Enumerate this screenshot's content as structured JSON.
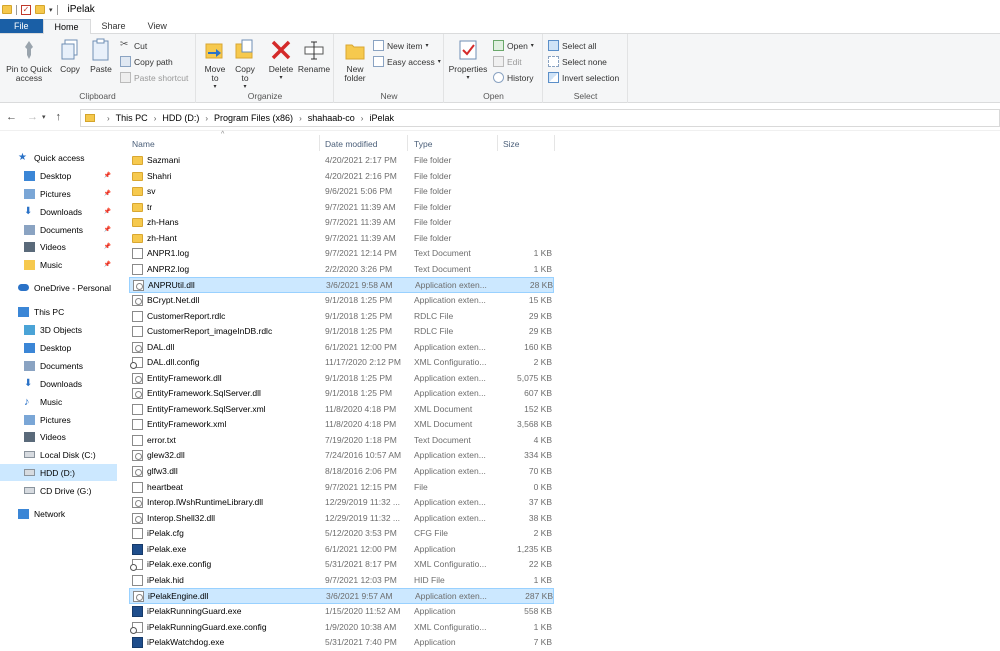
{
  "window": {
    "title": "iPelak"
  },
  "tabs": [
    "File",
    "Home",
    "Share",
    "View"
  ],
  "ribbon": {
    "clipboard": {
      "label": "Clipboard",
      "pin": "Pin to Quick access",
      "copy": "Copy",
      "paste": "Paste",
      "cut": "Cut",
      "copy_path": "Copy path",
      "paste_shortcut": "Paste shortcut"
    },
    "organize": {
      "label": "Organize",
      "move_to": "Move to",
      "copy_to": "Copy to",
      "delete": "Delete",
      "rename": "Rename"
    },
    "new": {
      "label": "New",
      "new_folder": "New folder",
      "new_item": "New item",
      "easy_access": "Easy access"
    },
    "open": {
      "label": "Open",
      "properties": "Properties",
      "open": "Open",
      "edit": "Edit",
      "history": "History"
    },
    "select": {
      "label": "Select",
      "select_all": "Select all",
      "select_none": "Select none",
      "invert": "Invert selection"
    }
  },
  "breadcrumb": [
    "This PC",
    "HDD (D:)",
    "Program Files (x86)",
    "shahaab-co",
    "iPelak"
  ],
  "nav": [
    {
      "label": "Quick access",
      "icon": "star-icon"
    },
    {
      "label": "Desktop",
      "icon": "desktop-icon",
      "pinned": true
    },
    {
      "label": "Pictures",
      "icon": "pictures-icon",
      "pinned": true
    },
    {
      "label": "Downloads",
      "icon": "download-icon",
      "pinned": true
    },
    {
      "label": "Documents",
      "icon": "documents-icon",
      "pinned": true
    },
    {
      "label": "Videos",
      "icon": "videos-icon",
      "pinned": true
    },
    {
      "label": "Music",
      "icon": "folder-icon",
      "pinned": true
    },
    {
      "label": "OneDrive - Personal",
      "icon": "cloud-icon"
    },
    {
      "label": "This PC",
      "icon": "computer-icon"
    },
    {
      "label": "3D Objects",
      "icon": "cube-icon"
    },
    {
      "label": "Desktop",
      "icon": "desktop-icon"
    },
    {
      "label": "Documents",
      "icon": "documents-icon"
    },
    {
      "label": "Downloads",
      "icon": "download-icon"
    },
    {
      "label": "Music",
      "icon": "music-icon"
    },
    {
      "label": "Pictures",
      "icon": "pictures-icon"
    },
    {
      "label": "Videos",
      "icon": "videos-icon"
    },
    {
      "label": "Local Disk (C:)",
      "icon": "drive-icon"
    },
    {
      "label": "HDD (D:)",
      "icon": "drive-icon",
      "selected": true
    },
    {
      "label": "CD Drive (G:)",
      "icon": "cd-icon"
    },
    {
      "label": "Network",
      "icon": "network-icon"
    }
  ],
  "columns": {
    "name": "Name",
    "date": "Date modified",
    "type": "Type",
    "size": "Size"
  },
  "files": [
    {
      "name": "Sazmani",
      "date": "4/20/2021 2:17 PM",
      "type": "File folder",
      "size": "",
      "icon": "folder"
    },
    {
      "name": "Shahri",
      "date": "4/20/2021 2:16 PM",
      "type": "File folder",
      "size": "",
      "icon": "folder"
    },
    {
      "name": "sv",
      "date": "9/6/2021 5:06 PM",
      "type": "File folder",
      "size": "",
      "icon": "folder"
    },
    {
      "name": "tr",
      "date": "9/7/2021 11:39 AM",
      "type": "File folder",
      "size": "",
      "icon": "folder"
    },
    {
      "name": "zh-Hans",
      "date": "9/7/2021 11:39 AM",
      "type": "File folder",
      "size": "",
      "icon": "folder"
    },
    {
      "name": "zh-Hant",
      "date": "9/7/2021 11:39 AM",
      "type": "File folder",
      "size": "",
      "icon": "folder"
    },
    {
      "name": "ANPR1.log",
      "date": "9/7/2021 12:14 PM",
      "type": "Text Document",
      "size": "1 KB",
      "icon": "doc"
    },
    {
      "name": "ANPR2.log",
      "date": "2/2/2020 3:26 PM",
      "type": "Text Document",
      "size": "1 KB",
      "icon": "doc"
    },
    {
      "name": "ANPRUtil.dll",
      "date": "3/6/2021 9:58 AM",
      "type": "Application exten...",
      "size": "28 KB",
      "icon": "dll",
      "selected": true
    },
    {
      "name": "BCrypt.Net.dll",
      "date": "9/1/2018 1:25 PM",
      "type": "Application exten...",
      "size": "15 KB",
      "icon": "dll"
    },
    {
      "name": "CustomerReport.rdlc",
      "date": "9/1/2018 1:25 PM",
      "type": "RDLC File",
      "size": "29 KB",
      "icon": "doc"
    },
    {
      "name": "CustomerReport_imageInDB.rdlc",
      "date": "9/1/2018 1:25 PM",
      "type": "RDLC File",
      "size": "29 KB",
      "icon": "doc"
    },
    {
      "name": "DAL.dll",
      "date": "6/1/2021 12:00 PM",
      "type": "Application exten...",
      "size": "160 KB",
      "icon": "dll"
    },
    {
      "name": "DAL.dll.config",
      "date": "11/17/2020 2:12 PM",
      "type": "XML Configuratio...",
      "size": "2 KB",
      "icon": "config"
    },
    {
      "name": "EntityFramework.dll",
      "date": "9/1/2018 1:25 PM",
      "type": "Application exten...",
      "size": "5,075 KB",
      "icon": "dll"
    },
    {
      "name": "EntityFramework.SqlServer.dll",
      "date": "9/1/2018 1:25 PM",
      "type": "Application exten...",
      "size": "607 KB",
      "icon": "dll"
    },
    {
      "name": "EntityFramework.SqlServer.xml",
      "date": "11/8/2020 4:18 PM",
      "type": "XML Document",
      "size": "152 KB",
      "icon": "doc"
    },
    {
      "name": "EntityFramework.xml",
      "date": "11/8/2020 4:18 PM",
      "type": "XML Document",
      "size": "3,568 KB",
      "icon": "doc"
    },
    {
      "name": "error.txt",
      "date": "7/19/2020 1:18 PM",
      "type": "Text Document",
      "size": "4 KB",
      "icon": "doc"
    },
    {
      "name": "glew32.dll",
      "date": "7/24/2016 10:57 AM",
      "type": "Application exten...",
      "size": "334 KB",
      "icon": "dll"
    },
    {
      "name": "glfw3.dll",
      "date": "8/18/2016 2:06 PM",
      "type": "Application exten...",
      "size": "70 KB",
      "icon": "dll"
    },
    {
      "name": "heartbeat",
      "date": "9/7/2021 12:15 PM",
      "type": "File",
      "size": "0 KB",
      "icon": "doc"
    },
    {
      "name": "Interop.IWshRuntimeLibrary.dll",
      "date": "12/29/2019 11:32 ...",
      "type": "Application exten...",
      "size": "37 KB",
      "icon": "dll"
    },
    {
      "name": "Interop.Shell32.dll",
      "date": "12/29/2019 11:32 ...",
      "type": "Application exten...",
      "size": "38 KB",
      "icon": "dll"
    },
    {
      "name": "iPelak.cfg",
      "date": "5/12/2020 3:53 PM",
      "type": "CFG File",
      "size": "2 KB",
      "icon": "doc"
    },
    {
      "name": "iPelak.exe",
      "date": "6/1/2021 12:00 PM",
      "type": "Application",
      "size": "1,235 KB",
      "icon": "exe"
    },
    {
      "name": "iPelak.exe.config",
      "date": "5/31/2021 8:17 PM",
      "type": "XML Configuratio...",
      "size": "22 KB",
      "icon": "config"
    },
    {
      "name": "iPelak.hid",
      "date": "9/7/2021 12:03 PM",
      "type": "HID File",
      "size": "1 KB",
      "icon": "doc"
    },
    {
      "name": "iPelakEngine.dll",
      "date": "3/6/2021 9:57 AM",
      "type": "Application exten...",
      "size": "287 KB",
      "icon": "dll",
      "selected": true
    },
    {
      "name": "iPelakRunningGuard.exe",
      "date": "1/15/2020 11:52 AM",
      "type": "Application",
      "size": "558 KB",
      "icon": "exe"
    },
    {
      "name": "iPelakRunningGuard.exe.config",
      "date": "1/9/2020 10:38 AM",
      "type": "XML Configuratio...",
      "size": "1 KB",
      "icon": "config"
    },
    {
      "name": "iPelakWatchdog.exe",
      "date": "5/31/2021 7:40 PM",
      "type": "Application",
      "size": "7 KB",
      "icon": "exe"
    }
  ]
}
